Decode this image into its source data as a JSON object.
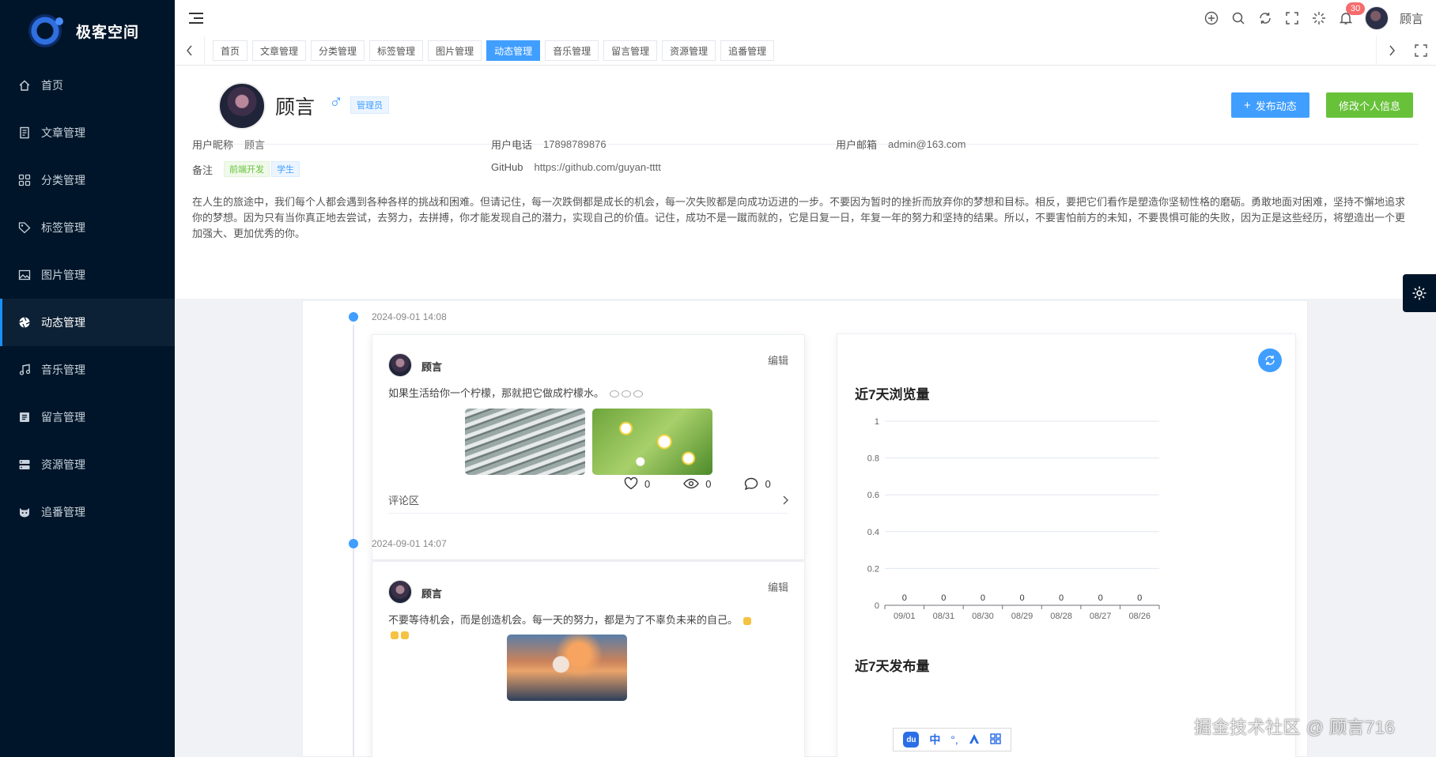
{
  "sidebar": {
    "logo_text": "极客空间",
    "items": [
      {
        "label": "首页",
        "icon": "home-icon"
      },
      {
        "label": "文章管理",
        "icon": "document-icon"
      },
      {
        "label": "分类管理",
        "icon": "grid-icon"
      },
      {
        "label": "标签管理",
        "icon": "tag-icon"
      },
      {
        "label": "图片管理",
        "icon": "image-icon"
      },
      {
        "label": "动态管理",
        "icon": "aperture-icon",
        "active": true
      },
      {
        "label": "音乐管理",
        "icon": "music-icon"
      },
      {
        "label": "留言管理",
        "icon": "message-icon"
      },
      {
        "label": "资源管理",
        "icon": "storage-icon"
      },
      {
        "label": "追番管理",
        "icon": "cat-icon"
      }
    ]
  },
  "header": {
    "notification_count": "30",
    "username": "顾言"
  },
  "tabs": [
    "首页",
    "文章管理",
    "分类管理",
    "标签管理",
    "图片管理",
    "动态管理",
    "音乐管理",
    "留言管理",
    "资源管理",
    "追番管理"
  ],
  "active_tab": "动态管理",
  "profile": {
    "name": "顾言",
    "gender_symbol": "♂",
    "role": "管理员",
    "publish_button": "发布动态",
    "edit_button": "修改个人信息",
    "nickname_label": "用户昵称",
    "nickname": "顾言",
    "phone_label": "用户电话",
    "phone": "17898789876",
    "email_label": "用户邮箱",
    "email": "admin@163.com",
    "remark_label": "备注",
    "remark_tags": [
      "前端开发",
      "学生"
    ],
    "github_label": "GitHub",
    "github": "https://github.com/guyan-tttt",
    "bio": "在人生的旅途中，我们每个人都会遇到各种各样的挑战和困难。但请记住，每一次跌倒都是成长的机会，每一次失败都是向成功迈进的一步。不要因为暂时的挫折而放弃你的梦想和目标。相反，要把它们看作是塑造你坚韧性格的磨砺。勇敢地面对困难，坚持不懈地追求你的梦想。因为只有当你真正地去尝试，去努力，去拼搏，你才能发现自己的潜力，实现自己的价值。记住，成功不是一蹴而就的，它是日复一日，年复一年的努力和坚持的结果。所以，不要害怕前方的未知，不要畏惧可能的失败，因为正是这些经历，将塑造出一个更加强大、更加优秀的你。"
  },
  "posts": [
    {
      "time": "2024-09-01 14:08",
      "user": "顾言",
      "edit_label": "编辑",
      "text": "如果生活给你一个柠檬，那就把它做成柠檬水。",
      "likes": "0",
      "views": "0",
      "comments": "0",
      "comment_area_label": "评论区"
    },
    {
      "time": "2024-09-01 14:07",
      "user": "顾言",
      "edit_label": "编辑",
      "text": "不要等待机会，而是创造机会。每一天的努力，都是为了不辜负未来的自己。"
    }
  ],
  "chart_data": {
    "type": "bar",
    "title": "近7天浏览量",
    "categories": [
      "09/01",
      "08/31",
      "08/30",
      "08/29",
      "08/28",
      "08/27",
      "08/26"
    ],
    "values": [
      0,
      0,
      0,
      0,
      0,
      0,
      0
    ],
    "yticks": [
      "0",
      "0.2",
      "0.4",
      "0.6",
      "0.8",
      "1"
    ],
    "ylim": [
      0,
      1
    ],
    "grid": true
  },
  "second_chart_title": "近7天发布量",
  "watermark": "掘金技术社区 @ 顾言716",
  "ime": {
    "du": "du",
    "zh": "中"
  }
}
